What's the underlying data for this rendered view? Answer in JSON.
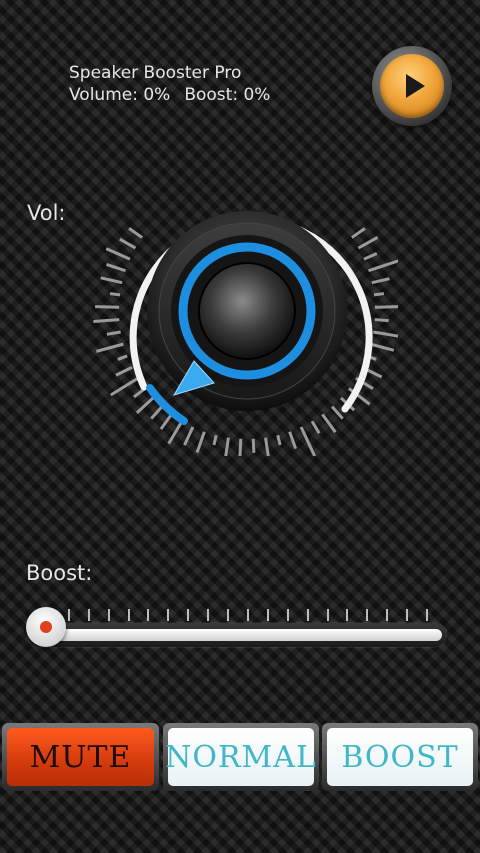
{
  "header": {
    "app_title": "Speaker Booster Pro",
    "volume_text": "Volume: 0%",
    "boost_text": "Boost: 0%"
  },
  "play_button": {
    "icon": "play-icon",
    "accent": "#f0a53a"
  },
  "volume_control": {
    "label": "Vol:",
    "value_percent": 0,
    "accent": "#1e8fe0"
  },
  "boost_control": {
    "label": "Boost:",
    "value_percent": 0,
    "tick_count": 20,
    "thumb_color": "#e2401c"
  },
  "buttons": {
    "mute": "MUTE",
    "normal": "NORMAL",
    "boost": "BOOST"
  }
}
